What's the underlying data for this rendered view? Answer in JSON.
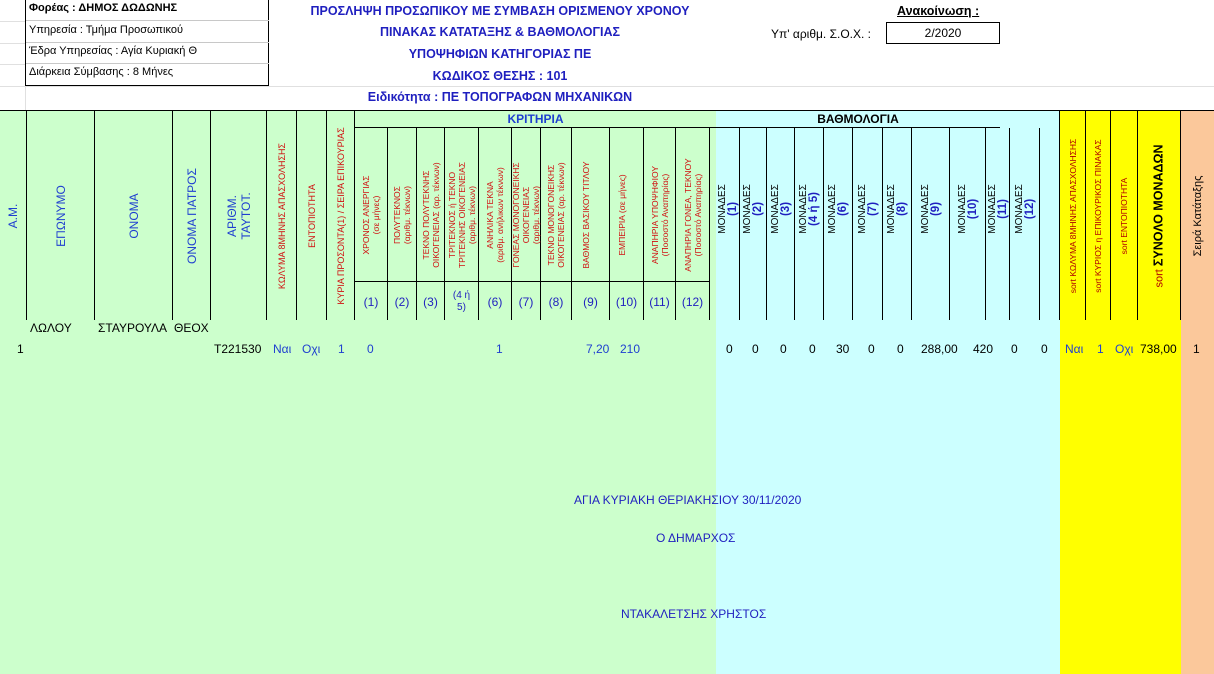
{
  "info": {
    "foreas": "Φορέας : ΔΗΜΟΣ ΔΩΔΩΝΗΣ",
    "ypiresia": "Υπηρεσία : Τμήμα Προσωπικού",
    "edra": "Έδρα Υπηρεσίας : Αγία Κυριακή Θ",
    "diarkeia": "Διάρκεια Σύμβασης :  8 Μήνες"
  },
  "titles": {
    "line1": "ΠΡΟΣΛΗΨΗ ΠΡΟΣΩΠΙΚΟΥ ΜΕ ΣΥΜΒΑΣΗ ΟΡΙΣΜΕΝΟΥ ΧΡΟΝΟΥ",
    "line2": "ΠΙΝΑΚΑΣ ΚΑΤΑΤΑΞΗΣ & ΒΑΘΜΟΛΟΓΙΑΣ",
    "line3": "ΥΠΟΨΗΦΙΩΝ ΚΑΤΗΓΟΡΙΑΣ ΠΕ",
    "line4": "ΚΩΔΙΚΟΣ ΘΕΣΗΣ : 101",
    "line5": "Ειδικότητα :  ΠΕ ΤΟΠΟΓΡΑΦΩΝ ΜΗΧΑΝΙΚΩΝ"
  },
  "announcement": {
    "label": "Ανακοίνωση :",
    "sox_label": "Υπ' αριθμ. Σ.Ο.Χ. :",
    "sox_value": "2/2020"
  },
  "headers": {
    "am": "Α.Μ.",
    "eponymo": "ΕΠΩΝΥΜΟ",
    "onoma": "ΟΝΟΜΑ",
    "patros": "ΟΝΟΜΑ ΠΑΤΡΟΣ",
    "taytot_1": "ΑΡΙΘΜ.",
    "taytot_2": "ΤΑΥΤΟΤ.",
    "kolyma": "ΚΩΛΥΜΑ 8ΜΗΝΗΣ ΑΠΑΣΧΟΛΗΣΗΣ",
    "entopiotita": "ΕΝΤΟΠΙΟΤΗΤΑ",
    "kyria": "ΚΥΡΙΑ ΠΡΟΣΟΝΤΑ(1) / ΣΕΙΡΑ ΕΠΙΚΟΥΡΙΑΣ",
    "kritiria": "ΚΡΙΤΗΡΙΑ",
    "vathmologia": "ΒΑΘΜΟΛΟΓΙΑ",
    "sort_kolyma": "sort  ΚΩΛΥΜΑ 8ΜΗΝΗΣ ΑΠΑΣΧΟΛΗΣΗΣ",
    "sort_kyrios": "sort ΚΥΡΙΟΣ η ΕΠΙΚΟΥΡΙΚΟΣ ΠΙΝΑΚΑΣ",
    "sort_entop": "sort  ΕΝΤΟΠΙΟΤΗΤΑ",
    "sort_synolo_pre": "sort ",
    "sort_synolo": "ΣΥΝΟΛΟ ΜΟΝΑΔΩΝ",
    "seira": "Σειρά Κατάταξης"
  },
  "criteria": [
    {
      "l1": "ΧΡΟΝΟΣ ΑΝΕΡΓΙΑΣ",
      "l2": "(σε μήνες)",
      "num": "(1)"
    },
    {
      "l1": "ΠΟΛΥΤΕΚΝΟΣ",
      "l2": "(αριθμ. τέκνων)",
      "num": "(2)"
    },
    {
      "l1": "ΤΕΚΝΟ ΠΟΛΥΤΕΚΝΗΣ",
      "l2": "ΟΙΚΟΓΕΝΕΙΑΣ  (αρ. τέκνων)",
      "num": "(3)"
    },
    {
      "l1": "ΤΡΙΤΕΚΝΟΣ ή ΤΕΚΝΟ",
      "l2": "ΤΡΙΤΕΚΝΗΣ ΟΙΚΟΓΕΝΕΙΑΣ",
      "l3": "(αριθμ. τέκνων)",
      "num": "(4 ή 5)"
    },
    {
      "l1": "ΑΝΗΛΙΚΑ ΤΕΚΝΑ",
      "l2": "(αριθμ. ανήλικων τέκνων)",
      "num": "(6)"
    },
    {
      "l1": "ΓΟΝΕΑΣ ΜΟΝΟΓΟΝΕΙΚΗΣ",
      "l2": "ΟΙΚΟΓΕΝΕΙΑΣ",
      "l3": "(αριθμ. τέκνων)",
      "num": "(7)"
    },
    {
      "l1": "ΤΕΚΝΟ ΜΟΝΟΓΟΝΕΙΚΗΣ",
      "l2": "ΟΙΚΟΓΕΝΕΙΑΣ  (αρ. τέκνων)",
      "num": "(8)"
    },
    {
      "l1": "ΒΑΘΜΟΣ ΒΑΣΙΚΟΥ ΤΙΤΛΟΥ",
      "l2": "",
      "num": "(9)"
    },
    {
      "l1": "ΕΜΠΕΙΡΙΑ (σε μήνες)",
      "l2": "",
      "num": "(10)"
    },
    {
      "l1": "ΑΝΑΠΗΡΙΑ ΥΠΟΨΗΦΙΟΥ",
      "l2": "(Ποσοστό  Αναπηρίας)",
      "num": "(11)"
    },
    {
      "l1": "ΑΝΑΠΗΡΙΑ ΓΟΝΕΑ, ΤΕΚΝΟΥ",
      "l2": "(Ποσοστό  Αναπηρίας)",
      "num": "(12)"
    }
  ],
  "monades": [
    {
      "word": "ΜΟΝΑΔΕΣ",
      "num": "(1)"
    },
    {
      "word": "ΜΟΝΑΔΕΣ",
      "num": "(2)"
    },
    {
      "word": "ΜΟΝΑΔΕΣ",
      "num": "(3)"
    },
    {
      "word": "ΜΟΝΑΔΕΣ",
      "num": "(4 ή 5)"
    },
    {
      "word": "ΜΟΝΑΔΕΣ",
      "num": "(6)"
    },
    {
      "word": "ΜΟΝΑΔΕΣ",
      "num": "(7)"
    },
    {
      "word": "ΜΟΝΑΔΕΣ",
      "num": "(8)"
    },
    {
      "word": "ΜΟΝΑΔΕΣ",
      "num": "(9)"
    },
    {
      "word": "ΜΟΝΑΔΕΣ",
      "num": "(10)"
    },
    {
      "word": "ΜΟΝΑΔΕΣ",
      "num": "(11)"
    },
    {
      "word": "ΜΟΝΑΔΕΣ",
      "num": "(12)"
    }
  ],
  "row": {
    "am": "1",
    "eponymo": "ΛΩΛΟΥ",
    "onoma": "ΣΤΑΥΡΟΥΛΑ",
    "patros": "ΘΕΟΧ",
    "taytot": "Τ221530",
    "kolyma": "Ναι",
    "entop": "Οχι",
    "kyria": "1",
    "k1": "0",
    "k6": "1",
    "k9": "7,20",
    "k10": "210",
    "m1": "0",
    "m2": "0",
    "m3": "0",
    "m4": "0",
    "m6": "30",
    "m7": "0",
    "m8": "0",
    "m9": "288,00",
    "m10": "420",
    "m11": "0",
    "m12": "0",
    "s_kolyma": "Ναι",
    "s_kyrios": "1",
    "s_entop": "Οχι",
    "s_synolo": "738,00",
    "seira": "1"
  },
  "signature": {
    "place_date": "ΑΓΙΑ ΚΥΡΙΑΚΗ ΘΕΡΙΑΚΗΣΙΟΥ 30/11/2020",
    "role": "Ο ΔΗΜΑΡΧΟΣ",
    "name": "ΝΤΑΚΑΛΕΤΣΗΣ ΧΡΗΣΤΟΣ"
  },
  "colors": {
    "green": "#ccffcc",
    "cyan": "#ccffff",
    "yellow": "#ffff00",
    "peach": "#fbc89b",
    "blue_text": "#1f3fd0",
    "red_text": "#d01010"
  }
}
